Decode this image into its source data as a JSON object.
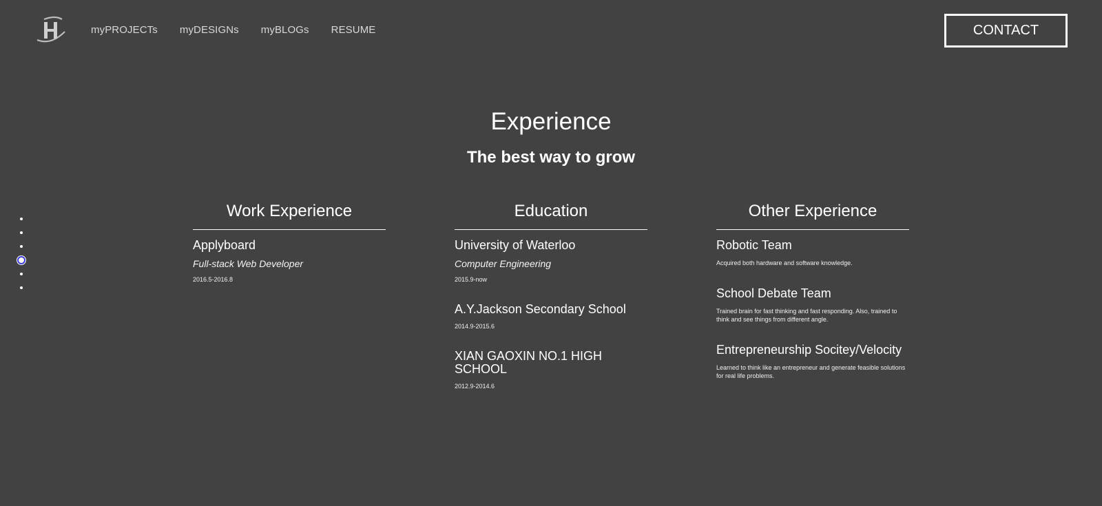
{
  "header": {
    "logo_icon": "sh-monogram-icon",
    "nav": [
      "myPROJECTs",
      "myDESIGNs",
      "myBLOGs",
      "RESUME"
    ],
    "contact_label": "CONTACT"
  },
  "side_nav": {
    "count": 6,
    "active_index": 3
  },
  "section": {
    "title": "Experience",
    "subtitle": "The best way to grow"
  },
  "columns": [
    {
      "heading": "Work Experience",
      "entries": [
        {
          "title": "Applyboard",
          "role": "Full-stack Web Developer",
          "date": "2016.5-2016.8"
        }
      ]
    },
    {
      "heading": "Education",
      "entries": [
        {
          "title": "University of Waterloo",
          "role": "Computer Engineering",
          "date": "2015.9-now"
        },
        {
          "title": "A.Y.Jackson Secondary School",
          "date": "2014.9-2015.6"
        },
        {
          "title": "XIAN GAOXIN NO.1 HIGH SCHOOL",
          "date": "2012.9-2014.6"
        }
      ]
    },
    {
      "heading": "Other Experience",
      "entries": [
        {
          "title": "Robotic Team",
          "desc": "Acquired both hardware and software knowledge."
        },
        {
          "title": "School Debate Team",
          "desc": "Trained brain for fast thinking and fast responding. Also, trained to think and see things from different angle."
        },
        {
          "title": "Entrepreneurship Socitey/Velocity",
          "desc": "Learned to think like an entrepreneur and generate feasible solutions for real life problems."
        }
      ]
    }
  ]
}
